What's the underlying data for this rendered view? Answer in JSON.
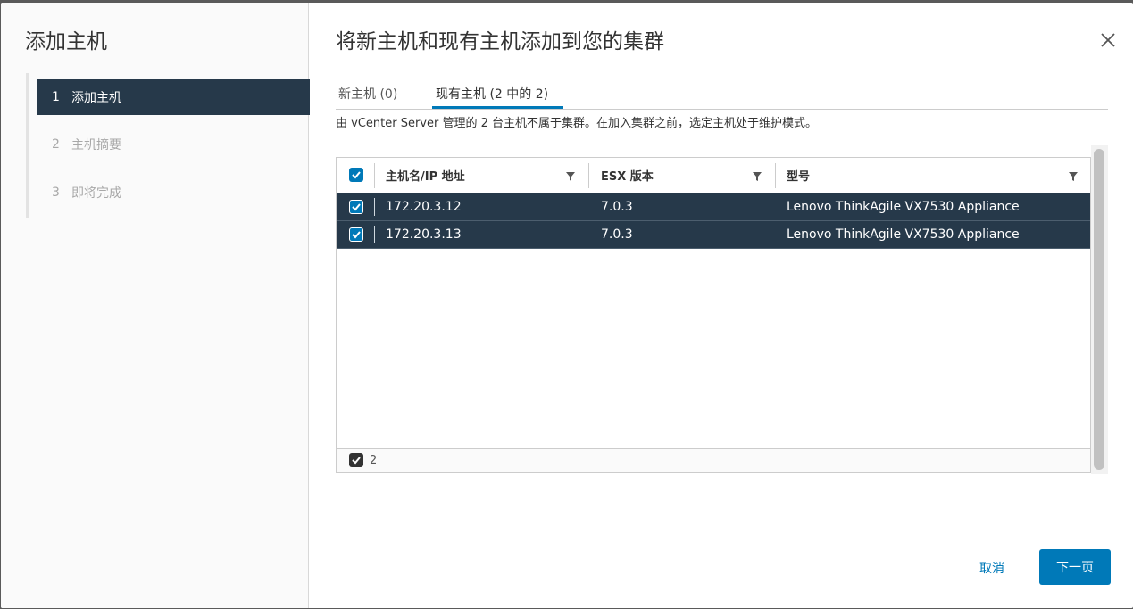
{
  "sidebar": {
    "title": "添加主机",
    "steps": [
      {
        "num": "1",
        "label": "添加主机"
      },
      {
        "num": "2",
        "label": "主机摘要"
      },
      {
        "num": "3",
        "label": "即将完成"
      }
    ]
  },
  "main": {
    "title": "将新主机和现有主机添加到您的集群",
    "tabs": [
      {
        "label": "新主机 (0)"
      },
      {
        "label": "现有主机 (2 中的 2)"
      }
    ],
    "description": "由 vCenter Server 管理的 2 台主机不属于集群。在加入集群之前，选定主机处于维护模式。",
    "grid": {
      "columns": [
        "主机名/IP 地址",
        "ESX 版本",
        "型号"
      ],
      "rows": [
        {
          "host": "172.20.3.12",
          "esx": "7.0.3",
          "model": "Lenovo ThinkAgile VX7530 Appliance"
        },
        {
          "host": "172.20.3.13",
          "esx": "7.0.3",
          "model": "Lenovo ThinkAgile VX7530 Appliance"
        }
      ],
      "selected_count": "2"
    },
    "buttons": {
      "cancel": "取消",
      "next": "下一页"
    }
  },
  "colors": {
    "accent": "#0079b8",
    "selected_row": "#26394a"
  },
  "icons": {
    "close": "close-icon",
    "filter": "filter-icon",
    "checkbox": "checkbox-checked-icon"
  }
}
